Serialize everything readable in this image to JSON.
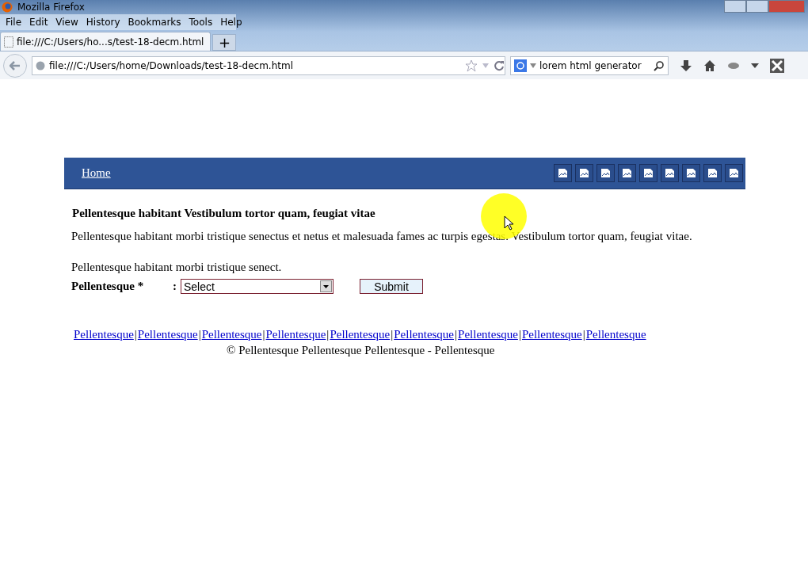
{
  "window": {
    "title": "Mozilla Firefox"
  },
  "menu": [
    "File",
    "Edit",
    "View",
    "History",
    "Bookmarks",
    "Tools",
    "Help"
  ],
  "tabs": [
    {
      "label": "file:///C:/Users/ho...s/test-18-decm.html",
      "selected": true
    }
  ],
  "new_tab": "+",
  "address_bar": {
    "value": "file:///C:/Users/home/Downloads/test-18-decm.html"
  },
  "search": {
    "value": "lorem html generator"
  },
  "page": {
    "nav": {
      "home": "Home"
    },
    "heading": "Pellentesque habitant Vestibulum tortor quam, feugiat vitae",
    "paragraph": "Pellentesque habitant morbi tristique senectus et netus et malesuada fames ac turpis egestas. Vestibulum tortor quam, feugiat vitae.",
    "intro": "Pellentesque habitant morbi tristique senect.",
    "form": {
      "label": "Pellentesque *",
      "colon": ":",
      "select": "Select",
      "submit": "Submit"
    },
    "footer_links": [
      {
        "text": "Pellentesque",
        "sep": "|"
      },
      {
        "text": "Pellentesque",
        "sep": "|"
      },
      {
        "text": "Pellentesque",
        "sep": "|"
      },
      {
        "text": "Pellentesque",
        "sep": "|"
      },
      {
        "text": "Pellentesque",
        "sep": "|"
      },
      {
        "text": "Pellentesque",
        "sep": "|"
      },
      {
        "text": "Pellentesque",
        "sep": "|"
      },
      {
        "text": "Pellentesque",
        "sep": "|"
      },
      {
        "text": "Pellentesque"
      }
    ],
    "copyright": "© Pellentesque Pellentesque Pellentesque - Pellentesque"
  }
}
